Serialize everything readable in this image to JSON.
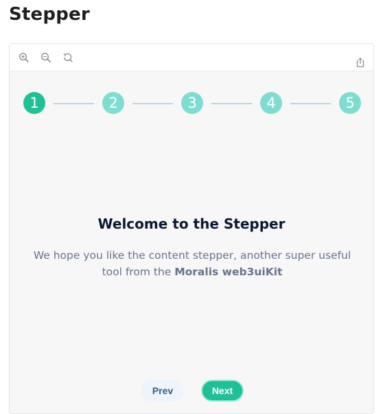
{
  "page": {
    "title": "Stepper"
  },
  "toolbar": {
    "icons": [
      "zoom-in-icon",
      "zoom-out-icon",
      "reset-zoom-icon",
      "share-icon"
    ]
  },
  "stepper": {
    "steps": [
      "1",
      "2",
      "3",
      "4",
      "5"
    ],
    "active_step": 1,
    "colors": {
      "active": "#21bf96",
      "inactive": "#7fdcd0",
      "connector": "#b8d3e0"
    }
  },
  "content": {
    "title": "Welcome to the Stepper",
    "body_prefix": "We hope you like the content stepper, another super useful tool from the",
    "body_bold": "Moralis web3uiKit"
  },
  "navigation": {
    "prev_label": "Prev",
    "next_label": "Next"
  }
}
